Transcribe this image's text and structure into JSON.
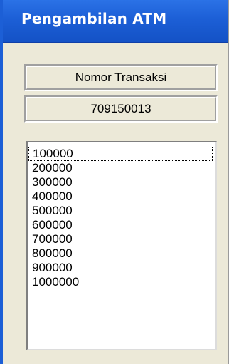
{
  "window": {
    "title": "Pengambilan ATM"
  },
  "fields": {
    "heading": "Nomor Transaksi",
    "transaction_number": "709150013"
  },
  "amount_list": {
    "focused_index": 0,
    "items": [
      "100000",
      "200000",
      "300000",
      "400000",
      "500000",
      "600000",
      "700000",
      "800000",
      "900000",
      "1000000"
    ]
  },
  "colors": {
    "title_bar": "#1c5fd6",
    "window_bg": "#ece9d8",
    "list_bg": "#ffffff"
  }
}
